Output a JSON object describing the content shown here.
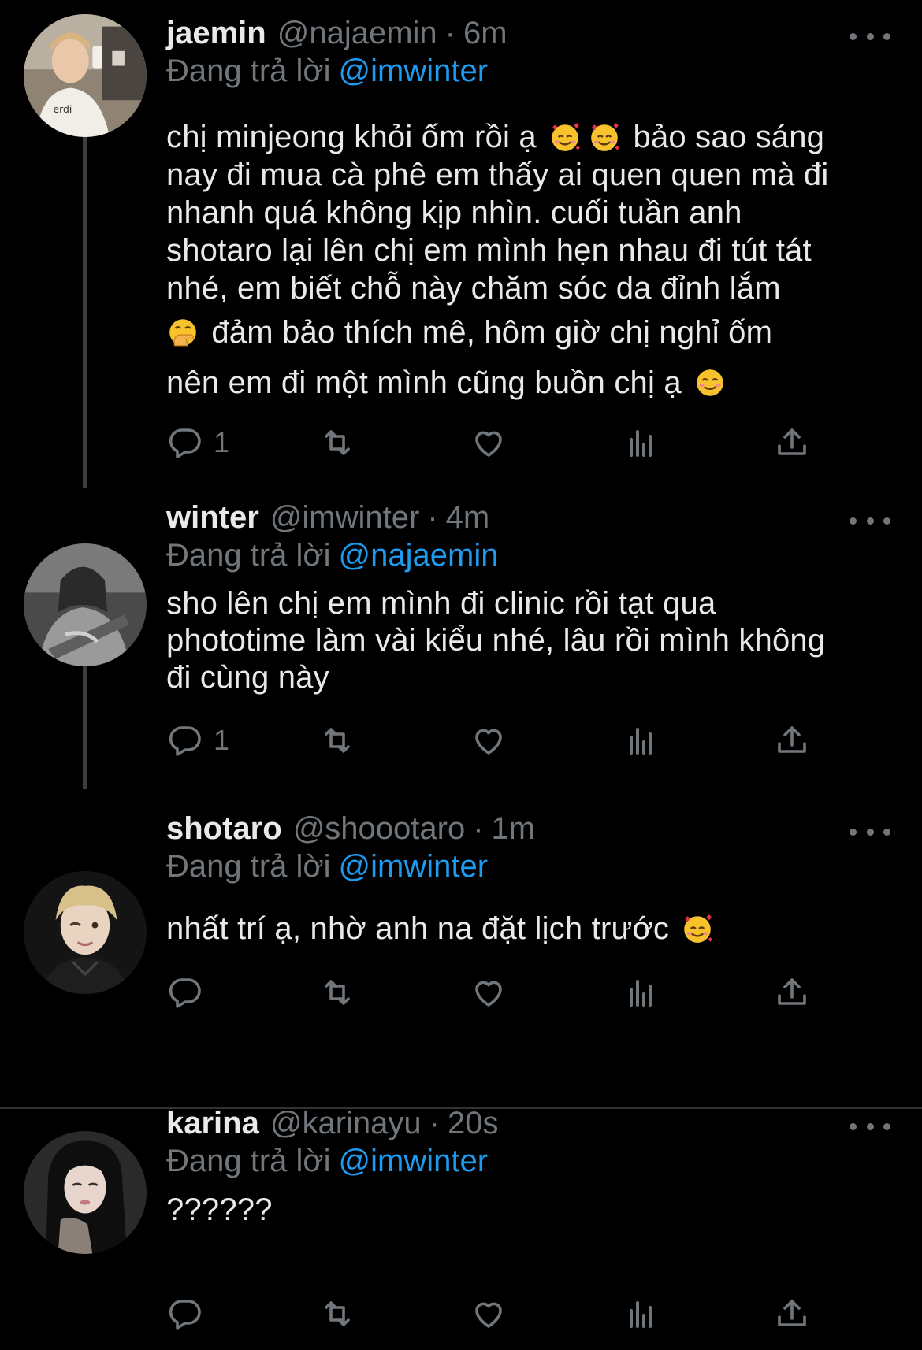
{
  "colors": {
    "background": "#000000",
    "text_primary": "#e7e9ea",
    "text_secondary": "#71767b",
    "accent_link": "#1d9bf0",
    "thread_line": "#3a3d42",
    "divider": "#2f3336"
  },
  "tweets": [
    {
      "name": "jaemin",
      "handle": "@najaemin",
      "dot": "·",
      "time": "6m",
      "reply_prefix": "Đang trả lời",
      "reply_to": "@imwinter",
      "lines": [
        {
          "text": "chị minjeong khỏi ốm rồi ạ",
          "emojis": [
            "smiling-face-with-hearts-icon",
            "smiling-face-with-hearts-icon"
          ],
          "after": " bảo sao sáng"
        },
        {
          "text": "nay đi mua cà phê em thấy ai quen quen mà đi"
        },
        {
          "text": "nhanh quá không kịp nhìn. cuối tuần anh"
        },
        {
          "text": "shotaro lại lên chị em mình hẹn nhau đi tút tát"
        },
        {
          "text": "nhé, em biết chỗ này chăm sóc da đỉnh lắm"
        },
        {
          "lead_emoji": "hand-over-mouth-icon",
          "text": " đảm bảo thích mê, hôm giờ chị nghỉ ốm"
        },
        {
          "text": "nên em đi một mình cũng buồn chị ạ",
          "emojis": [
            "smiling-face-icon"
          ]
        }
      ],
      "reply_count": "1",
      "avatar": "jaemin-avatar"
    },
    {
      "name": "winter",
      "handle": "@imwinter",
      "dot": "·",
      "time": "4m",
      "reply_prefix": "Đang trả lời",
      "reply_to": "@najaemin",
      "lines": [
        {
          "text": "sho lên chị em mình đi clinic rồi tạt qua"
        },
        {
          "text": "phototime làm vài kiểu nhé, lâu rồi mình không"
        },
        {
          "text": "đi cùng này"
        }
      ],
      "reply_count": "1",
      "avatar": "winter-avatar"
    },
    {
      "name": "shotaro",
      "handle": "@shoootaro",
      "dot": "·",
      "time": "1m",
      "reply_prefix": "Đang trả lời",
      "reply_to": "@imwinter",
      "lines": [
        {
          "text": "nhất trí ạ, nhờ anh na đặt lịch trước",
          "emojis": [
            "smiling-face-with-hearts-icon"
          ]
        }
      ],
      "reply_count": "",
      "avatar": "shotaro-avatar"
    },
    {
      "name": "karina",
      "handle": "@karinayu",
      "dot": "·",
      "time": "20s",
      "reply_prefix": "Đang trả lời",
      "reply_to": "@imwinter",
      "lines": [
        {
          "text": "??????"
        }
      ],
      "reply_count": "",
      "avatar": "karina-avatar"
    }
  ],
  "action_icons": [
    "reply-icon",
    "retweet-icon",
    "like-icon",
    "views-icon",
    "share-icon"
  ]
}
